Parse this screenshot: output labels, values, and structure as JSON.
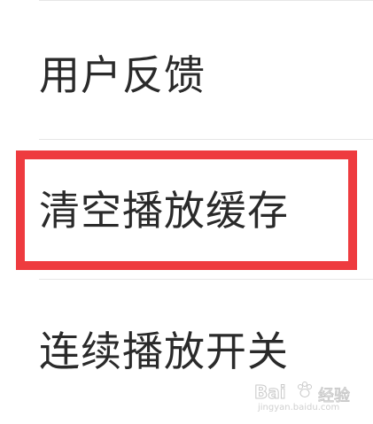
{
  "menu": {
    "items": [
      {
        "label": "用户反馈"
      },
      {
        "label": "清空播放缓存",
        "highlighted": true
      },
      {
        "label": "连续播放开关"
      }
    ]
  },
  "highlight_color": "#ee3b3f",
  "watermark": {
    "brand": "Bai",
    "jingyan": "经验",
    "url": "jingyan.baidu.com",
    "icon": "paw-icon"
  }
}
